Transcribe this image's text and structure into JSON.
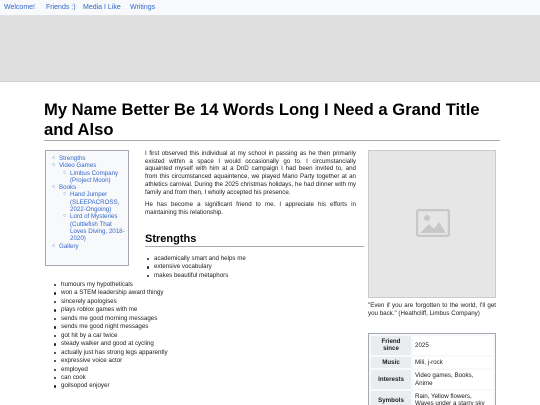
{
  "nav": {
    "items": [
      {
        "label": "Welcome!"
      },
      {
        "label": "Friends :)"
      },
      {
        "label": "Media I Like"
      },
      {
        "label": "Writings"
      }
    ]
  },
  "page": {
    "title": "My Name Better Be 14 Words Long I Need a Grand Title and Also"
  },
  "toc": {
    "items": [
      {
        "label": "Strengths"
      },
      {
        "label": "Video Games"
      },
      {
        "label": "Limbus Company (Project Moon)"
      },
      {
        "label": "Books"
      },
      {
        "label": "Hand Jumper (SLEEPACROSS, 2022-Ongoing)"
      },
      {
        "label": "Lord of Mysteries (Cuttlefish That Loves Diving, 2018-2020)"
      },
      {
        "label": "Gallery"
      }
    ]
  },
  "intro": {
    "p1": "I first observed this individual at my school in passing as he then primarily existed within a space I would occasionally go to. I circumstancially aquainted myself with him at a DnD campaign I had been invited to, and from this circumstanced aquaintence, we played Mario Party together at an athletics carnival. During the 2025 christmas holidays, he had dinner with my family and from then, I wholly accepted his presence.",
    "p2": "He has become a significant friend to me. I appreciate his efforts in maintaining this relationship."
  },
  "strengths": {
    "heading": "Strengths",
    "items": [
      "academically smart and helps me",
      "extensive vocabulary",
      "makes beautiful metaphors",
      "humours my hypotheticals",
      "won a STEM leadership award thingy",
      "sincerely apologises",
      "plays roblox games with me",
      "sends me good morning messages",
      "sends me good night messages",
      "got hit by a car twice",
      "steady walker and good at cycling",
      "actually just has strong legs apparently",
      "expressive voice actor",
      "employed",
      "can cook",
      "goilsopod enjoyer"
    ]
  },
  "infobox": {
    "image_icon": "image-placeholder-icon",
    "caption": "\"Even if you are forgotten to the world, I'll get you back.\" (Heathcliff, Limbus Company)",
    "rows": [
      {
        "label": "Friend since",
        "value": "2025"
      },
      {
        "label": "Music",
        "value": "Mili, j-rock"
      },
      {
        "label": "Interests",
        "value": "Video games, Books, Anime"
      },
      {
        "label": "Symbols",
        "value": "Rain, Yellow flowers, Waves under a starry sky"
      }
    ]
  },
  "colors": {
    "link": "#3366cc",
    "banner": "#dedede",
    "border": "#a2a9b1"
  }
}
